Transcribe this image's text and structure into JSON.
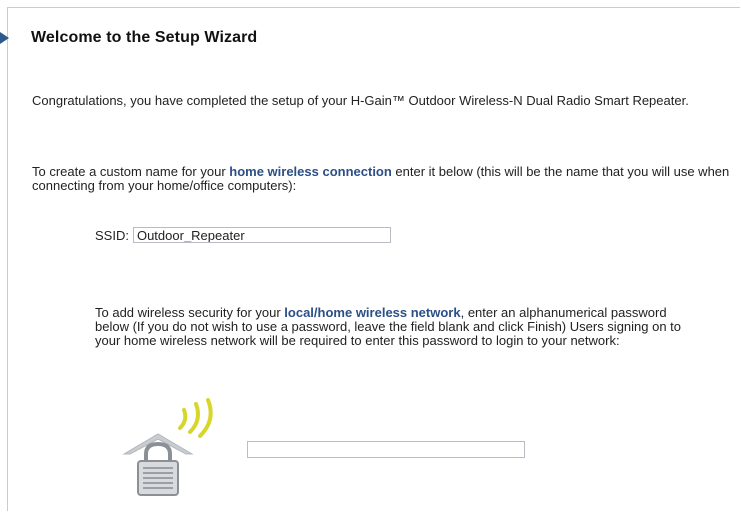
{
  "wizard": {
    "title": "Welcome to the Setup Wizard"
  },
  "intro": {
    "text": "Congratulations, you have completed the setup of your H-Gain™ Outdoor Wireless-N Dual Radio Smart Repeater."
  },
  "ssid_section": {
    "text_before": "To create a custom name for your ",
    "highlight": "home wireless connection",
    "text_after": " enter it below (this will be the name that you will use when connecting from your home/office computers):",
    "label": "SSID:",
    "value": "Outdoor_Repeater"
  },
  "security_section": {
    "text_before": "To add wireless security for your ",
    "highlight": "local/home wireless network",
    "text_after": ", enter an alphanumerical password below (If you do not wish to use a password, leave the field blank and click Finish) Users signing on to your home wireless network will be required to enter this password to login to your network:",
    "password_value": ""
  },
  "colors": {
    "accent": "#2b4f86",
    "title_marker": "#2c5a8c",
    "signal": "#d7d62a"
  },
  "icons": {
    "title_marker": "triangle-marker-icon",
    "lock": "house-lock-wireless-icon"
  }
}
